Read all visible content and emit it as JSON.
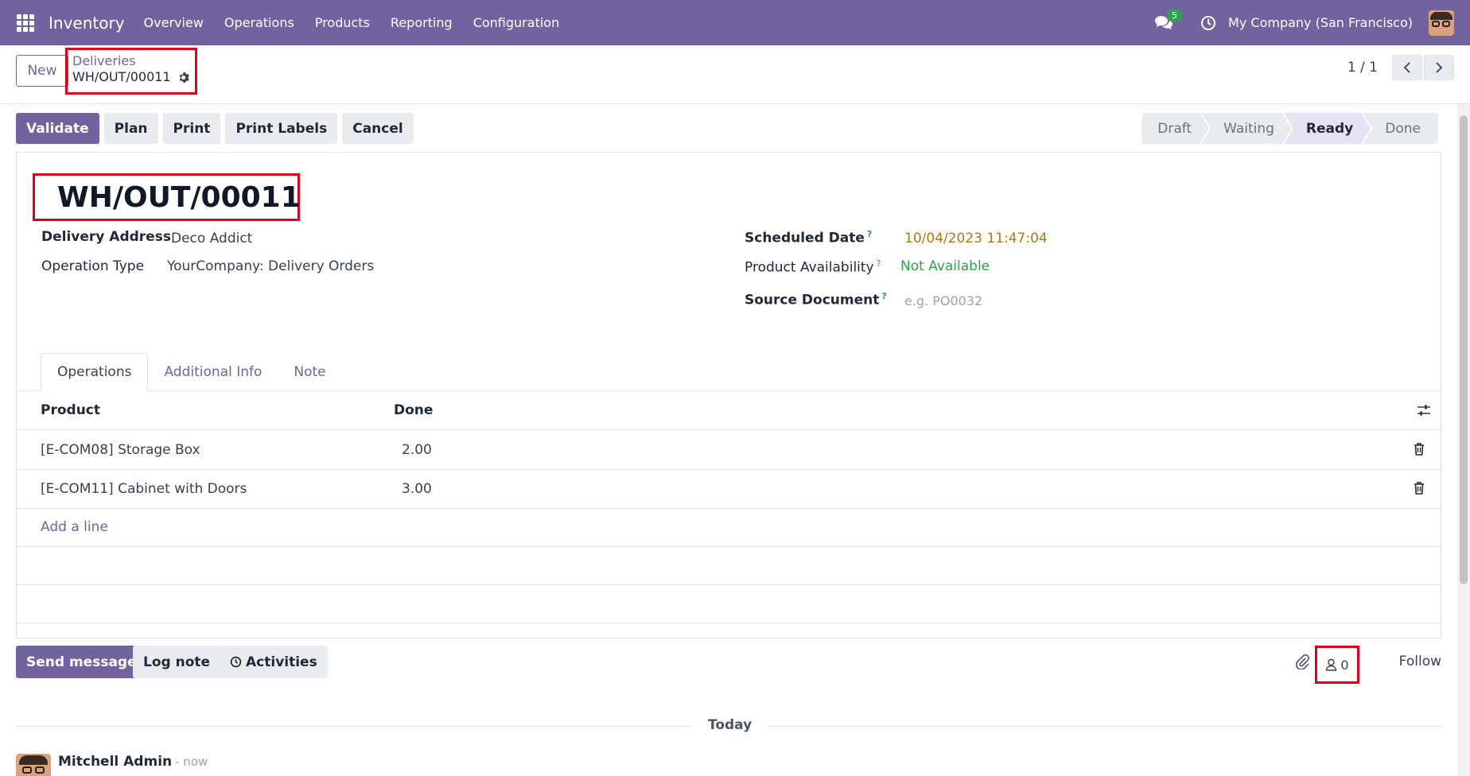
{
  "navbar": {
    "app_name": "Inventory",
    "menu": [
      "Overview",
      "Operations",
      "Products",
      "Reporting",
      "Configuration"
    ],
    "chat_count": "5",
    "company": "My Company (San Francisco)"
  },
  "control": {
    "new_label": "New",
    "breadcrumb_parent": "Deliveries",
    "breadcrumb_current": "WH/OUT/00011",
    "pager": "1 / 1"
  },
  "actions": {
    "validate": "Validate",
    "plan": "Plan",
    "print": "Print",
    "print_labels": "Print Labels",
    "cancel": "Cancel"
  },
  "status": {
    "stages": [
      "Draft",
      "Waiting",
      "Ready",
      "Done"
    ],
    "active": "Ready"
  },
  "record": {
    "title": "WH/OUT/00011",
    "delivery_address_label": "Delivery Address",
    "delivery_address": "Deco Addict",
    "operation_type_label": "Operation Type",
    "operation_type": "YourCompany: Delivery Orders",
    "scheduled_date_label": "Scheduled Date",
    "scheduled_date": "10/04/2023 11:47:04",
    "availability_label": "Product Availability",
    "availability": "Not Available",
    "source_document_label": "Source Document",
    "source_document_placeholder": "e.g. PO0032",
    "help_mark": "?"
  },
  "tabs": [
    "Operations",
    "Additional Info",
    "Note"
  ],
  "table": {
    "headers": {
      "product": "Product",
      "done": "Done"
    },
    "rows": [
      {
        "product": "[E-COM08] Storage Box",
        "done": "2.00"
      },
      {
        "product": "[E-COM11] Cabinet with Doors",
        "done": "3.00"
      }
    ],
    "add_line": "Add a line"
  },
  "chatter": {
    "send_message": "Send message",
    "log_note": "Log note",
    "activities": "Activities",
    "followers_count": "0",
    "follow": "Follow",
    "today": "Today",
    "author": "Mitchell Admin",
    "time": "- now"
  },
  "colors": {
    "brand": "#71639e",
    "highlight": "#e0001b",
    "success": "#28a745",
    "date_warning": "#b07a0b"
  }
}
